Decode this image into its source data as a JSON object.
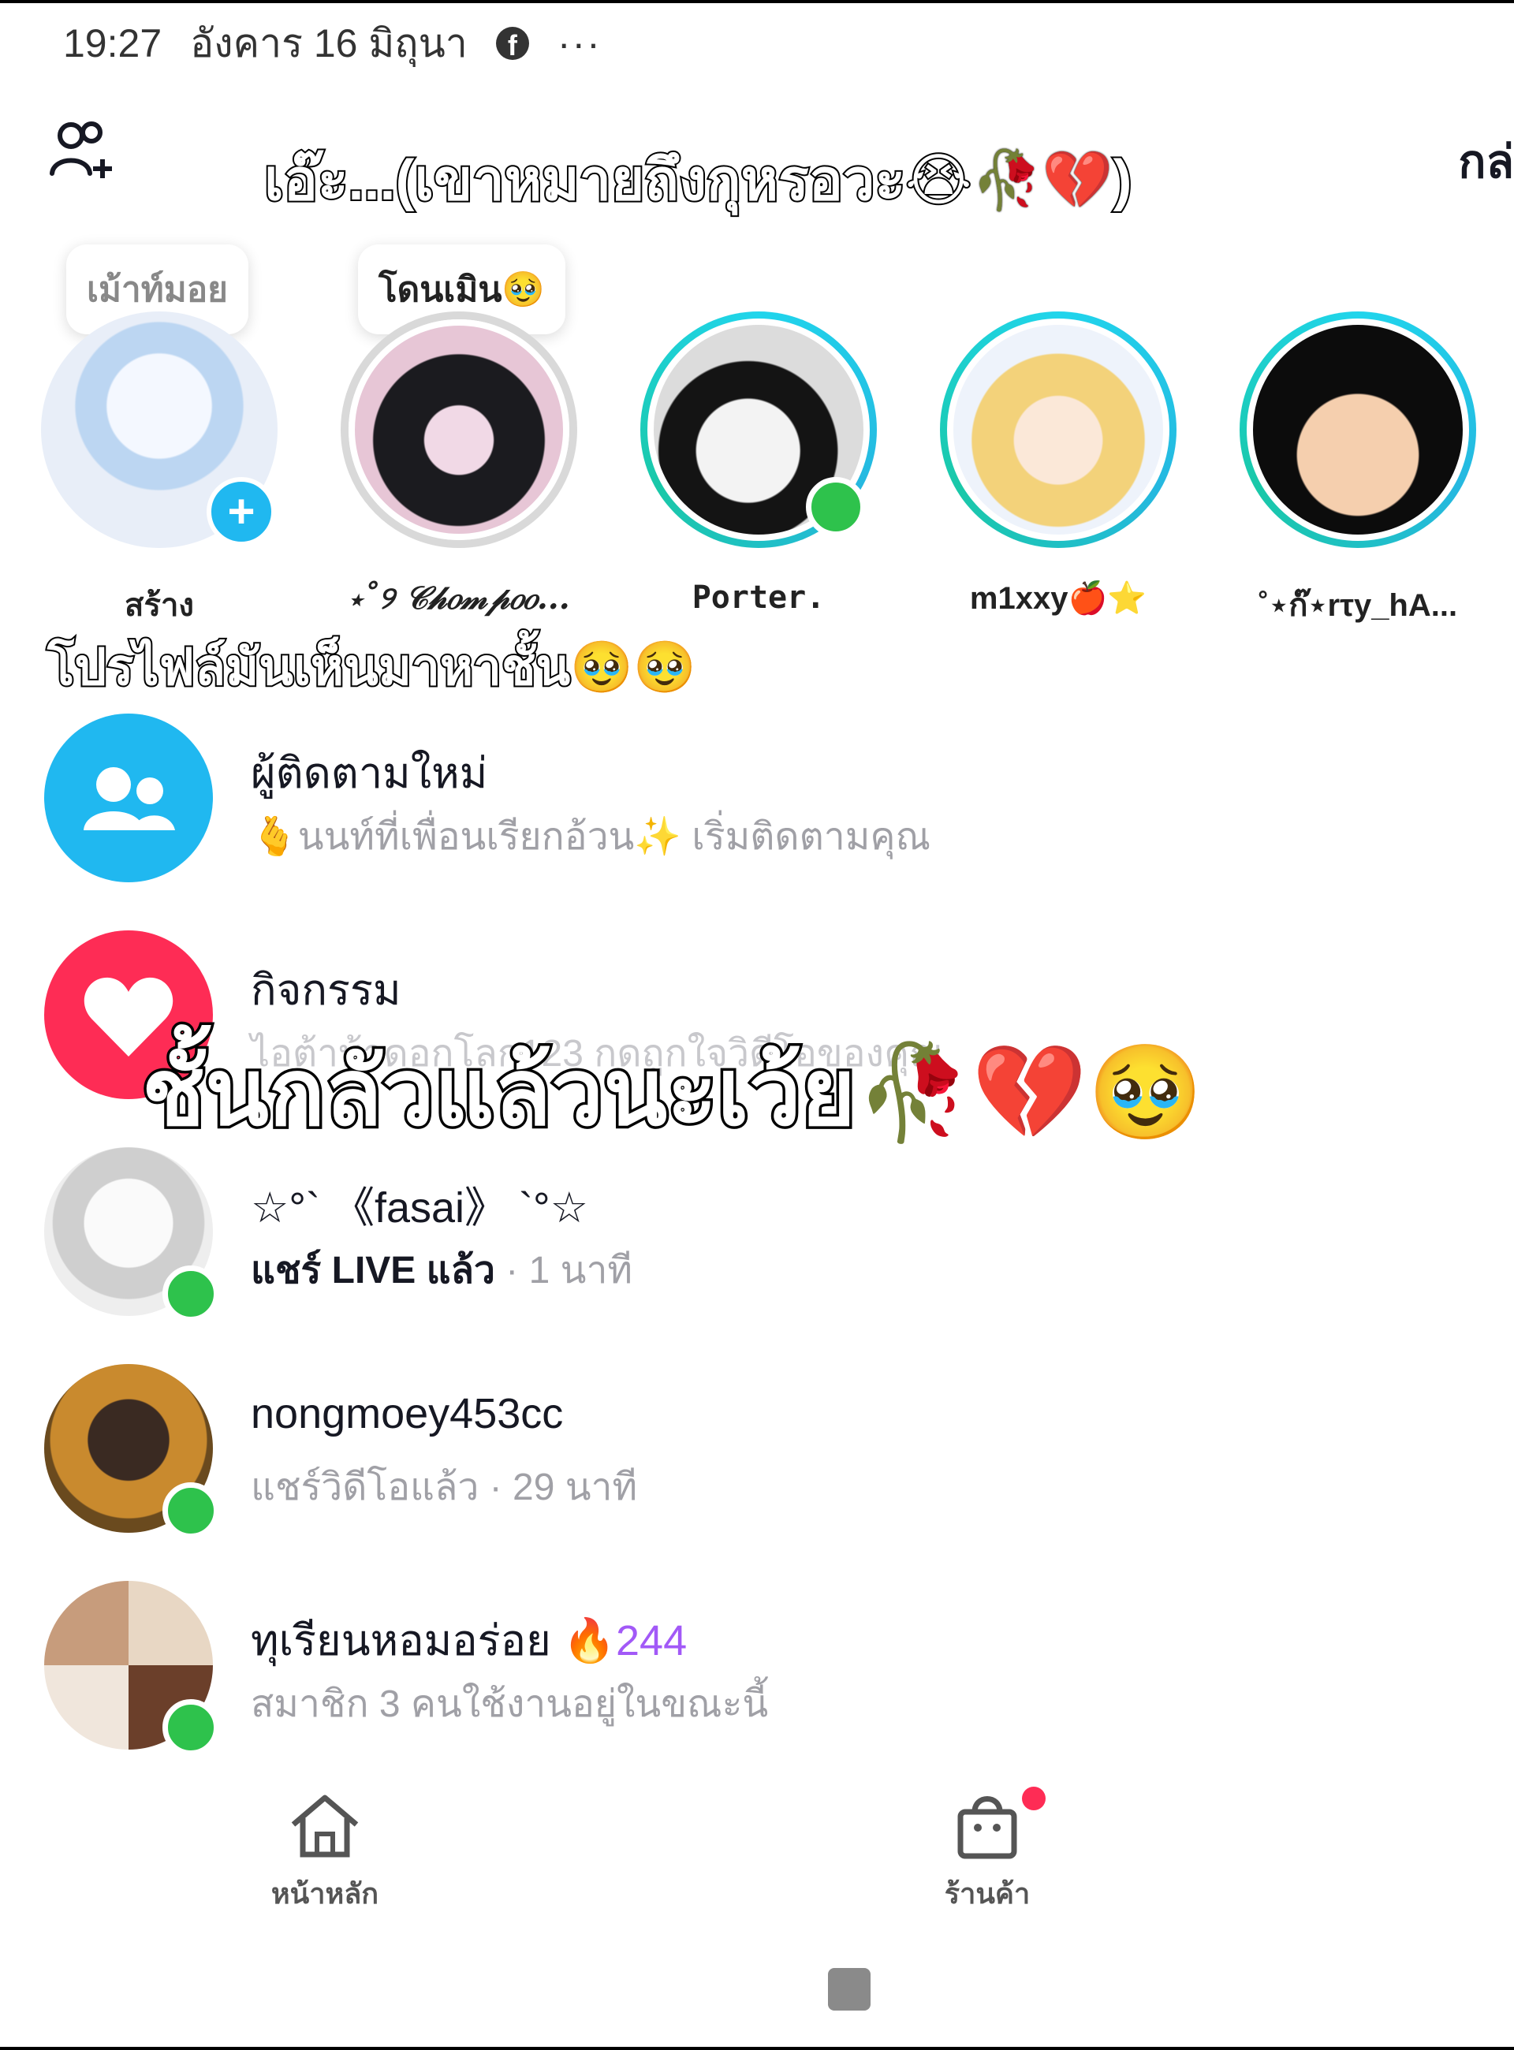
{
  "status_bar": {
    "time": "19:27",
    "date": "อังคาร 16 มิถุนา",
    "app_icon": "f",
    "more": "···"
  },
  "header": {
    "add_friend_icon": "add-friend-icon",
    "caption_top": "เอ๊ะ...(เขาหมายถึงกุหรอวะ😭🥀💔)",
    "right_text": "กล่"
  },
  "stories": [
    {
      "name": "สร้าง",
      "bubble": "เม้าท์มอย",
      "badge": "+"
    },
    {
      "name": "⋆˚୨ 𝒞𝒽𝑜𝓂𝓅𝑜𝑜...",
      "bubble": "โดนเมิน🥹"
    },
    {
      "name": "Porter.",
      "online": true
    },
    {
      "name": "m1xxy🍎⭐"
    },
    {
      "name": "˚⋆ก๊⋆rτy_hA..."
    }
  ],
  "caption_mid": "โปรไฟล์มันเห็นมาหาชั้น🥹🥹",
  "inbox": {
    "new_followers": {
      "title": "ผู้ติดตามใหม่",
      "subtitle": "🫰นนท์ที่เพื่อนเรียกอ้วน✨ เริ่มติดตามคุณ"
    },
    "activity": {
      "title": "กิจกรรม",
      "subtitle": "ไอต้าบ้าดอกโลก123 กดถูกใจวิดีโอของคุณ"
    },
    "chats": [
      {
        "title": "☆°` 《fasai》 `°☆",
        "sub_bold": "แชร์ LIVE แล้ว",
        "sub_rest": " · 1 นาที"
      },
      {
        "title": "nongmoey453cc",
        "sub_rest": "แชร์วิดีโอแล้ว · 29 นาที"
      },
      {
        "title": "ทุเรียนหอมอร่อย",
        "fire": "🔥",
        "count": "244",
        "sub_rest": "สมาชิก 3 คนใช้งานอยู่ในขณะนี้"
      }
    ]
  },
  "caption_big": "ชั้นกลัวแล้วนะเว้ย",
  "caption_big_emojis": "🥀💔🥹😭",
  "bottom_nav": {
    "home": "หน้าหลัก",
    "shop": "ร้านค้า"
  },
  "colors": {
    "accent_blue": "#20b8f0",
    "accent_pink": "#fe2c55",
    "online_green": "#2ec24c",
    "story_ring": "#20d5ec"
  }
}
